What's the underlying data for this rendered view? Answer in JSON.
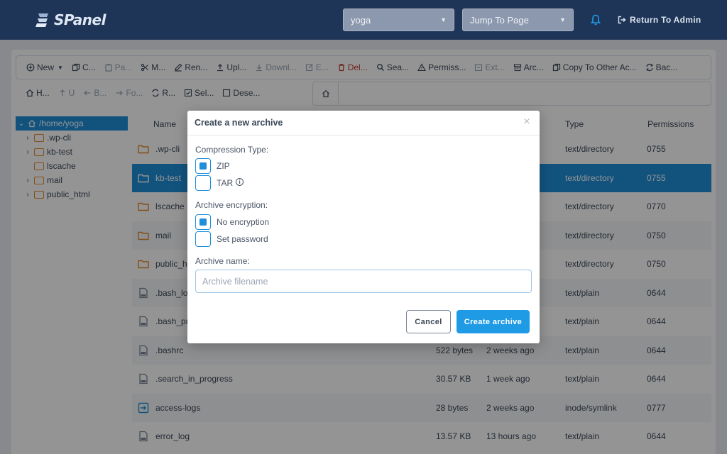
{
  "header": {
    "logo_text": "SPanel",
    "user_select": "yoga",
    "jump_select": "Jump To Page",
    "return_label": "Return To Admin"
  },
  "toolbar": [
    {
      "label": "New",
      "icon": "plus-circle-icon",
      "state": "normal",
      "has_dropdown": true
    },
    {
      "label": "C...",
      "icon": "copy-icon",
      "state": "normal"
    },
    {
      "label": "Pa...",
      "icon": "clipboard-icon",
      "state": "disabled"
    },
    {
      "label": "M...",
      "icon": "scissors-icon",
      "state": "normal"
    },
    {
      "label": "Ren...",
      "icon": "pencil-icon",
      "state": "normal"
    },
    {
      "label": "Upl...",
      "icon": "upload-icon",
      "state": "normal"
    },
    {
      "label": "Downl...",
      "icon": "download-icon",
      "state": "disabled"
    },
    {
      "label": "E...",
      "icon": "edit-icon",
      "state": "disabled"
    },
    {
      "label": "Del...",
      "icon": "trash-icon",
      "state": "danger"
    },
    {
      "label": "Sea...",
      "icon": "search-icon",
      "state": "normal"
    },
    {
      "label": "Permiss...",
      "icon": "warning-icon",
      "state": "normal"
    },
    {
      "label": "Ext...",
      "icon": "extract-icon",
      "state": "disabled"
    },
    {
      "label": "Arc...",
      "icon": "archive-icon",
      "state": "normal"
    },
    {
      "label": "Copy To Other Ac...",
      "icon": "copy-other-icon",
      "state": "normal"
    },
    {
      "label": "Bac...",
      "icon": "backup-icon",
      "state": "normal"
    }
  ],
  "toolbar2": [
    {
      "label": "H...",
      "icon": "home-icon",
      "state": "normal"
    },
    {
      "label": "U",
      "icon": "arrow-up-icon",
      "state": "disabled"
    },
    {
      "label": "B...",
      "icon": "arrow-left-icon",
      "state": "disabled"
    },
    {
      "label": "Fo...",
      "icon": "arrow-right-icon",
      "state": "disabled"
    },
    {
      "label": "R...",
      "icon": "refresh-icon",
      "state": "normal"
    },
    {
      "label": "Sel...",
      "icon": "check-square-icon",
      "state": "normal"
    },
    {
      "label": "Dese...",
      "icon": "square-icon",
      "state": "normal"
    }
  ],
  "tree": [
    {
      "label": "/home/yoga",
      "active": true,
      "expanded": true
    },
    {
      "label": ".wp-cli",
      "has_children": true
    },
    {
      "label": "kb-test",
      "has_children": true
    },
    {
      "label": "lscache",
      "has_children": false
    },
    {
      "label": "mail",
      "has_children": true
    },
    {
      "label": "public_html",
      "has_children": true
    }
  ],
  "table": {
    "columns": {
      "name": "Name",
      "type": "Type",
      "permissions": "Permissions"
    },
    "rows": [
      {
        "name": ".wp-cli",
        "size": "",
        "modified": "",
        "type": "text/directory",
        "perms": "0755",
        "kind": "folder"
      },
      {
        "name": "kb-test",
        "size": "",
        "modified": "",
        "type": "text/directory",
        "perms": "0755",
        "kind": "folder",
        "selected": true
      },
      {
        "name": "lscache",
        "size": "",
        "modified": "",
        "type": "text/directory",
        "perms": "0770",
        "kind": "folder"
      },
      {
        "name": "mail",
        "size": "",
        "modified": "",
        "type": "text/directory",
        "perms": "0750",
        "kind": "folder"
      },
      {
        "name": "public_ht",
        "size": "",
        "modified": "",
        "type": "text/directory",
        "perms": "0750",
        "kind": "folder"
      },
      {
        "name": ".bash_log",
        "size": "",
        "modified": "",
        "type": "text/plain",
        "perms": "0644",
        "kind": "file"
      },
      {
        "name": ".bash_pro",
        "size": "",
        "modified": "",
        "type": "text/plain",
        "perms": "0644",
        "kind": "file"
      },
      {
        "name": ".bashrc",
        "size": "522 bytes",
        "modified": "2 weeks ago",
        "type": "text/plain",
        "perms": "0644",
        "kind": "file"
      },
      {
        "name": ".search_in_progress",
        "size": "30.57 KB",
        "modified": "1 week ago",
        "type": "text/plain",
        "perms": "0644",
        "kind": "file"
      },
      {
        "name": "access-logs",
        "size": "28 bytes",
        "modified": "2 weeks ago",
        "type": "inode/symlink",
        "perms": "0777",
        "kind": "symlink"
      },
      {
        "name": "error_log",
        "size": "13.57 KB",
        "modified": "13 hours ago",
        "type": "text/plain",
        "perms": "0644",
        "kind": "file"
      }
    ]
  },
  "modal": {
    "title": "Create a new archive",
    "compression_label": "Compression Type:",
    "compression_options": [
      {
        "label": "ZIP",
        "checked": true
      },
      {
        "label": "TAR",
        "checked": false
      }
    ],
    "encryption_label": "Archive encryption:",
    "encryption_options": [
      {
        "label": "No encryption",
        "checked": true
      },
      {
        "label": "Set password",
        "checked": false
      }
    ],
    "name_label": "Archive name:",
    "name_placeholder": "Archive filename",
    "name_value": "",
    "cancel_label": "Cancel",
    "create_label": "Create archive"
  },
  "colors": {
    "header_bg": "#1f3557",
    "accent": "#1f9be6",
    "selected_row": "#1f8fd9",
    "folder": "#e08a2e",
    "danger": "#c0392b"
  }
}
